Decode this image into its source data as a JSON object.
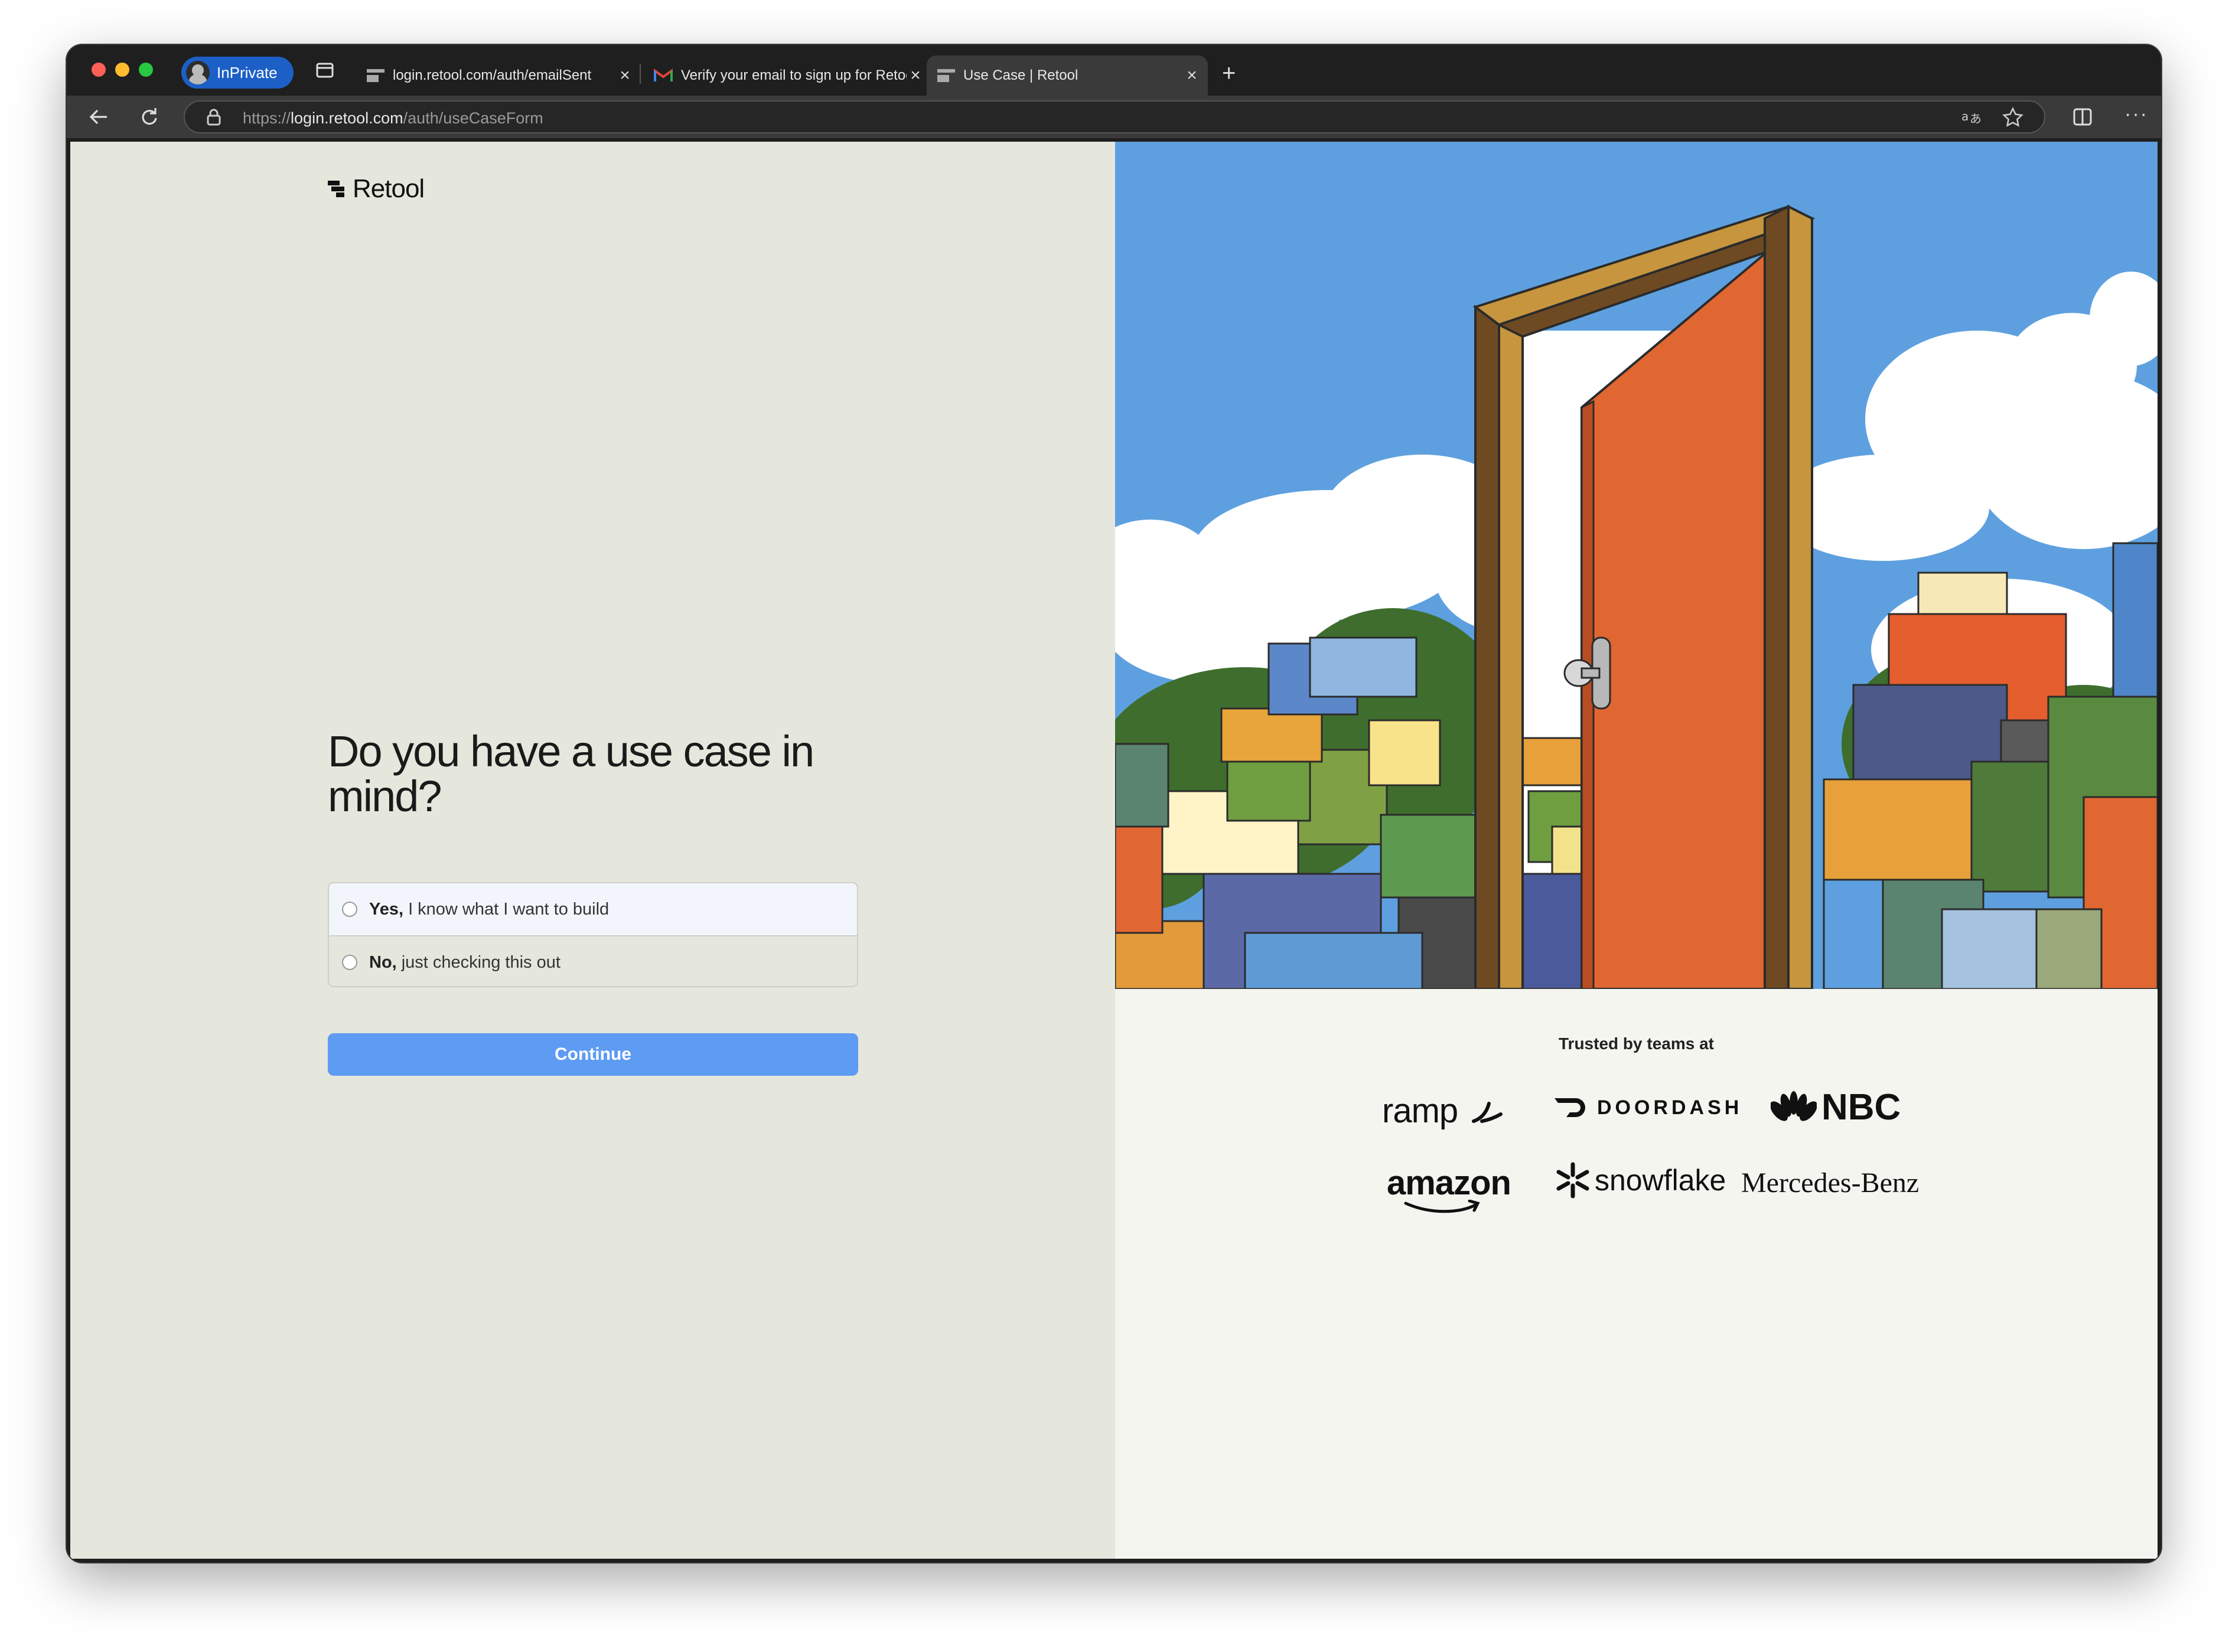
{
  "browser": {
    "inprivate_label": "InPrivate",
    "tabs": [
      {
        "title": "login.retool.com/auth/emailSent"
      },
      {
        "title": "Verify your email to sign up for Retool"
      },
      {
        "title": "Use Case | Retool"
      }
    ],
    "url_scheme": "https://",
    "url_host": "login.retool.com",
    "url_path": "/auth/useCaseForm"
  },
  "page": {
    "logo_text": "Retool",
    "heading": "Do you have a use case in mind?",
    "options": [
      {
        "bold": "Yes,",
        "text": "I know what I want to build"
      },
      {
        "bold": "No,",
        "text": "just checking this out"
      }
    ],
    "continue_label": "Continue"
  },
  "trusted": {
    "label": "Trusted by teams at",
    "brands": [
      "ramp",
      "DOORDASH",
      "NBC",
      "amazon",
      "snowflake",
      "Mercedes-Benz"
    ]
  },
  "colors": {
    "left_bg": "#e5e6dc",
    "right_bg": "#f5f5f0",
    "accent": "#5e9bf3",
    "sky": "#5ea0df",
    "door": "#e06632"
  }
}
